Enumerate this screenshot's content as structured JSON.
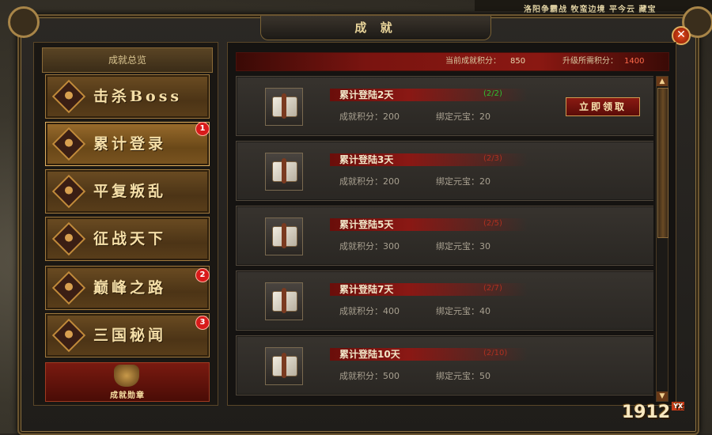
{
  "window": {
    "title": "成 就"
  },
  "world": {
    "top_text": "洛阳争霸战  牧蛮边境  平今云  藏宝"
  },
  "sidebar": {
    "header": "成就总览",
    "items": [
      {
        "label": "击杀Boss",
        "badge": ""
      },
      {
        "label": "累计登录",
        "badge": "1"
      },
      {
        "label": "平复叛乱",
        "badge": ""
      },
      {
        "label": "征战天下",
        "badge": ""
      },
      {
        "label": "巅峰之路",
        "badge": "2"
      },
      {
        "label": "三国秘闻",
        "badge": "3"
      }
    ],
    "medal_label": "成就勋章"
  },
  "points": {
    "current_label": "当前成就积分：",
    "current_value": "850",
    "next_label": "升级所需积分：",
    "next_value": "1400"
  },
  "achievements": [
    {
      "name": "累计登陆2天",
      "progress": "(2/2)",
      "complete": true,
      "points": "成就积分：200",
      "ingot": "绑定元宝：20",
      "claim_label": "立即领取"
    },
    {
      "name": "累计登陆3天",
      "progress": "(2/3)",
      "complete": false,
      "points": "成就积分：200",
      "ingot": "绑定元宝：20"
    },
    {
      "name": "累计登陆5天",
      "progress": "(2/5)",
      "complete": false,
      "points": "成就积分：300",
      "ingot": "绑定元宝：30"
    },
    {
      "name": "累计登陆7天",
      "progress": "(2/7)",
      "complete": false,
      "points": "成就积分：400",
      "ingot": "绑定元宝：40"
    },
    {
      "name": "累计登陆10天",
      "progress": "(2/10)",
      "complete": false,
      "points": "成就积分：500",
      "ingot": "绑定元宝：50"
    }
  ],
  "scrollbar": {
    "up": "▲",
    "down": "▼"
  },
  "close_label": "✕",
  "watermark": {
    "brand": "1912",
    "tag": "YX"
  }
}
